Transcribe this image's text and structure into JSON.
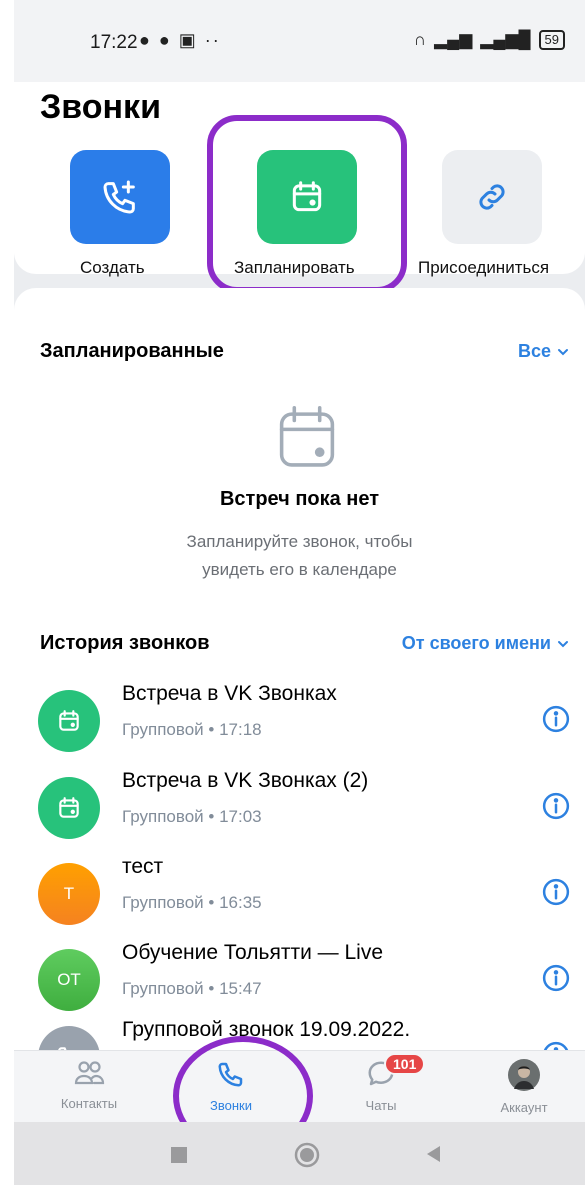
{
  "status_bar": {
    "time": "17:22",
    "battery": "59"
  },
  "page": {
    "title": "Звонки"
  },
  "actions": [
    {
      "label": "Создать",
      "icon": "phone-plus-icon",
      "color": "#2b7de9"
    },
    {
      "label": "Запланировать",
      "icon": "calendar-icon",
      "color": "#27c27b"
    },
    {
      "label": "Присоединиться",
      "icon": "link-icon",
      "color": "#eceef1"
    }
  ],
  "scheduled": {
    "title": "Запланированные",
    "filter": "Все",
    "empty_title": "Встреч пока нет",
    "empty_sub_line1": "Запланируйте звонок, чтобы",
    "empty_sub_line2": "увидеть его в календаре"
  },
  "history": {
    "title": "История звонков",
    "filter": "От своего имени",
    "items": [
      {
        "title": "Встреча в VK Звонках",
        "subtitle": "Групповой • 17:18",
        "avatar_type": "calendar",
        "avatar_color": "#27c27b"
      },
      {
        "title": "Встреча в VK Звонках (2)",
        "subtitle": "Групповой • 17:03",
        "avatar_type": "calendar",
        "avatar_color": "#27c27b"
      },
      {
        "title": "тест",
        "subtitle": "Групповой • 16:35",
        "avatar_text": "Т",
        "avatar_color": "#f7931e"
      },
      {
        "title": "Обучение Тольятти — Live",
        "subtitle": "Групповой • 15:47",
        "avatar_text": "ОТ",
        "avatar_color": "#4bb34b"
      },
      {
        "title": "Групповой звонок 19.09.2022.",
        "subtitle": "",
        "avatar_type": "phone",
        "avatar_color": "#99a2ad"
      }
    ]
  },
  "tabs": [
    {
      "label": "Контакты",
      "icon": "contacts-icon"
    },
    {
      "label": "Звонки",
      "icon": "phone-icon",
      "active": true
    },
    {
      "label": "Чаты",
      "icon": "chat-icon",
      "badge": "101"
    },
    {
      "label": "Аккаунт",
      "icon": "avatar"
    }
  ],
  "colors": {
    "accent": "#2d81e0",
    "highlight": "#8c2cc9",
    "badge": "#e64646"
  }
}
